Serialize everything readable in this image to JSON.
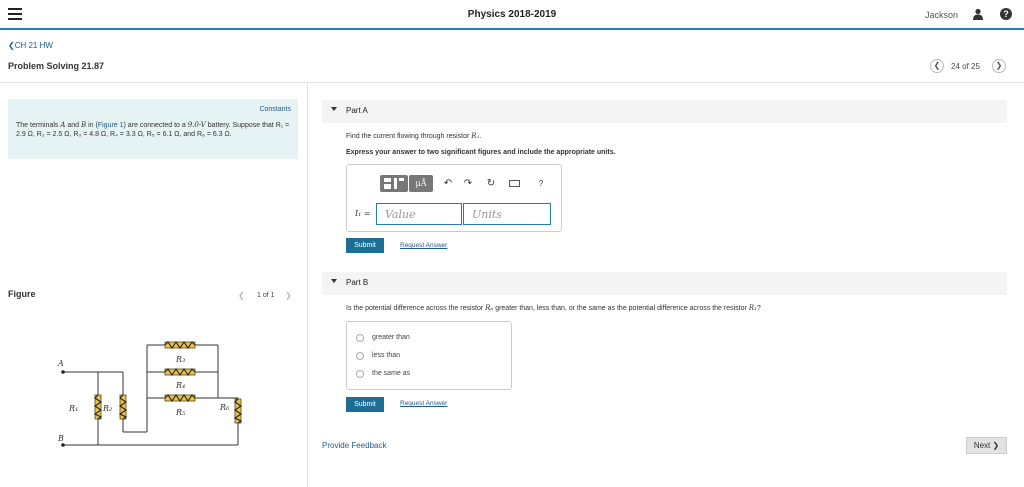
{
  "header": {
    "app_title": "Physics 2018-2019",
    "user_name": "Jackson",
    "help_label": "?"
  },
  "nav": {
    "back_label": "❮CH 21 HW",
    "problem_title": "Problem Solving 21.87",
    "prev_label": "❮",
    "count_label": "24 of 25",
    "next_label": "❯"
  },
  "problem": {
    "constants_label": "Constants",
    "text_pre": "The terminals ",
    "term_a": "A",
    "text_and": " and ",
    "term_b": "B",
    "text_in": " in (",
    "figure_link": "Figure 1",
    "text_post": ") are connected to a ",
    "voltage": "9.0-V",
    "text_battery": " battery. Suppose that ",
    "resistors_text": "R₁ = 2.9 Ω, R₂ = 2.5 Ω, R₃ = 4.8 Ω, R₄ = 3.3 Ω, R₅ = 6.1 Ω, and R₆ = 6.3 Ω."
  },
  "figure": {
    "label": "Figure",
    "prev": "❮",
    "count": "1 of 1",
    "next": "❯",
    "node_a": "A",
    "node_b": "B",
    "r1": "R₁",
    "r2": "R₂",
    "r3": "R₃",
    "r4": "R₄",
    "r5": "R₅",
    "r6": "R₆"
  },
  "partA": {
    "label": "Part A",
    "question_pre": "Find the current flowing through resistor ",
    "question_var": "R₁",
    "question_post": ".",
    "instructions": "Express your answer to two significant figures and include the appropriate units.",
    "toolbar_mu": "μÅ",
    "toolbar_undo": "↶",
    "toolbar_redo": "↷",
    "toolbar_reset": "↻",
    "toolbar_help": "?",
    "var_label": "I₁ =",
    "value_placeholder": "Value",
    "units_placeholder": "Units",
    "submit_label": "Submit",
    "request_label": "Request Answer"
  },
  "partB": {
    "label": "Part B",
    "question_pre": "Is the potential difference across the resistor ",
    "question_var1": "R₆",
    "question_mid": " greater than, less than, or the same as the potential difference across the resistor ",
    "question_var2": "R₁",
    "question_post": "?",
    "options": [
      "greater than",
      "less than",
      "the same as"
    ],
    "submit_label": "Submit",
    "request_label": "Request Answer"
  },
  "footer": {
    "feedback_label": "Provide Feedback",
    "next_label": "Next ❯"
  },
  "colors": {
    "accent": "#2a7bb0",
    "submit": "#1d6e95",
    "link": "#1d5b8c",
    "info_bg": "#e6f3f4",
    "resistor_fill": "#e8c24a"
  }
}
